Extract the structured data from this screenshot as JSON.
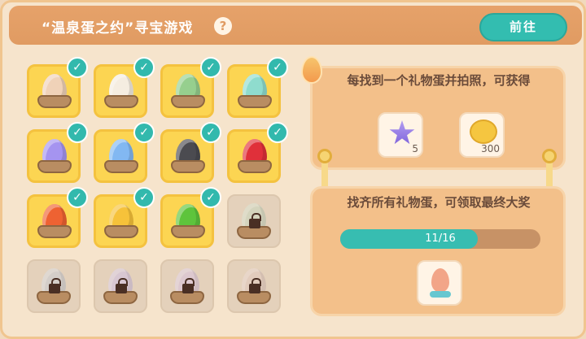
{
  "header": {
    "title": "“温泉蛋之约”寻宝游戏",
    "help_icon": "?",
    "go_button": "前往"
  },
  "colors": {
    "accent_teal": "#33bdb0",
    "header_orange": "#e09b62",
    "found_slot": "#fcd552",
    "locked_slot": "#e4d1bb"
  },
  "eggs": [
    {
      "color": "#f0d2b8",
      "found": true
    },
    {
      "color": "#f5ede1",
      "found": true
    },
    {
      "color": "#96cf8e",
      "found": true
    },
    {
      "color": "#8fdcce",
      "found": true
    },
    {
      "color": "#a594f0",
      "found": true
    },
    {
      "color": "#82b8f2",
      "found": true
    },
    {
      "color": "#4b4b50",
      "found": true
    },
    {
      "color": "#e0303a",
      "found": true
    },
    {
      "color": "#ee6232",
      "found": true
    },
    {
      "color": "#f6c23a",
      "found": true
    },
    {
      "color": "#5ec43c",
      "found": true
    },
    {
      "color": "#c8d8c0",
      "found": false
    },
    {
      "color": "#c8ccd6",
      "found": false
    },
    {
      "color": "#cfc0e6",
      "found": false
    },
    {
      "color": "#d8c2e0",
      "found": false
    },
    {
      "color": "#e2c8c0",
      "found": false
    }
  ],
  "check_mark": "✓",
  "reward_panel": {
    "text": "每找到一个礼物蛋并拍照，可获得",
    "rewards": [
      {
        "icon": "star-icon",
        "count": "5"
      },
      {
        "icon": "coin-icon",
        "count": "300"
      }
    ]
  },
  "grand_panel": {
    "text": "找齐所有礼物蛋，可领取最终大奖",
    "progress_text": "11/16",
    "progress_fraction": 0.6875,
    "prize_icon": "egg-trophy-icon"
  }
}
